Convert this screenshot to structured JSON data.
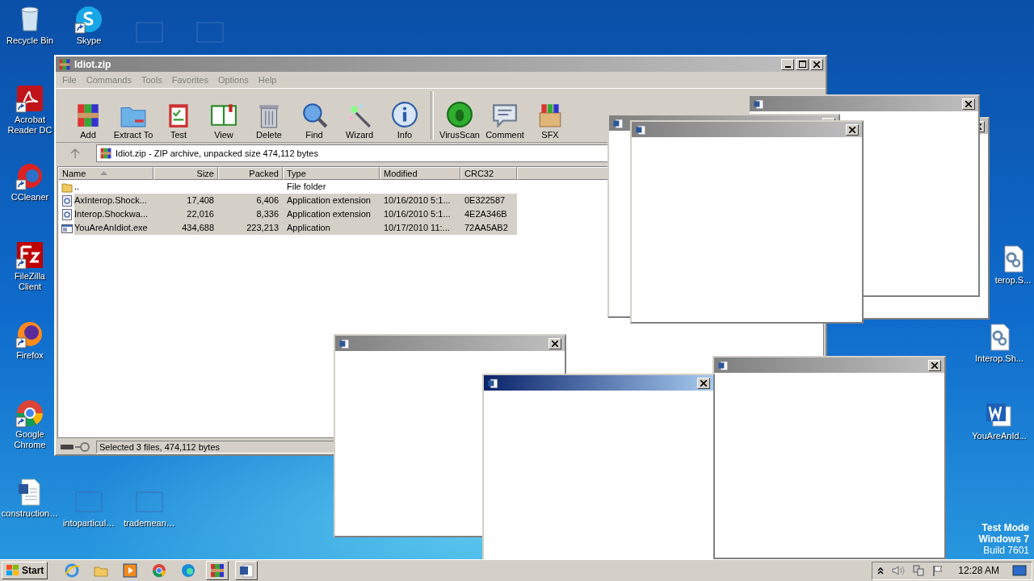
{
  "desktop_icons": [
    {
      "label": "Recycle Bin",
      "kind": "recycle",
      "shortcut": false
    },
    {
      "label": "Skype",
      "kind": "skype",
      "shortcut": true
    },
    {
      "kind": "thumb",
      "shortcut": false
    },
    {
      "kind": "thumb",
      "shortcut": false
    },
    {
      "label": "Acrobat Reader DC",
      "kind": "acrobat",
      "shortcut": true
    },
    {
      "label": "CCleaner",
      "kind": "ccleaner",
      "shortcut": true
    },
    {
      "label": "FileZilla Client",
      "kind": "filezilla",
      "shortcut": true
    },
    {
      "label": "Firefox",
      "kind": "firefox",
      "shortcut": true
    },
    {
      "label": "Google Chrome",
      "kind": "chrome",
      "shortcut": true
    },
    {
      "label": "construction…",
      "kind": "worddoc",
      "shortcut": false
    },
    {
      "label": "intoparticul…",
      "kind": "thumb",
      "shortcut": false
    },
    {
      "label": "trademean…",
      "kind": "thumb",
      "shortcut": false
    },
    {
      "label": "terop.S...",
      "kind": "gear",
      "shortcut": false
    },
    {
      "label": "Interop.Sh...",
      "kind": "gear",
      "shortcut": false
    },
    {
      "label": "YouAreAnId...",
      "kind": "word",
      "shortcut": false
    }
  ],
  "system_notice": [
    {
      "text": "Test Mode",
      "bold": true
    },
    {
      "text": "Windows 7",
      "bold": true
    },
    {
      "text": "Build 7601",
      "bold": false
    }
  ],
  "winrar": {
    "title": "Idiot.zip",
    "menu": [
      "File",
      "Commands",
      "Tools",
      "Favorites",
      "Options",
      "Help"
    ],
    "toolbar": [
      {
        "label": "Add",
        "kind": "add"
      },
      {
        "label": "Extract To",
        "kind": "extract"
      },
      {
        "label": "Test",
        "kind": "test"
      },
      {
        "label": "View",
        "kind": "view"
      },
      {
        "label": "Delete",
        "kind": "delete"
      },
      {
        "label": "Find",
        "kind": "find"
      },
      {
        "label": "Wizard",
        "kind": "wizard"
      },
      {
        "label": "Info",
        "kind": "info"
      },
      {
        "label": "VirusScan",
        "kind": "virus"
      },
      {
        "label": "Comment",
        "kind": "comment"
      },
      {
        "label": "SFX",
        "kind": "sfx"
      }
    ],
    "address": "Idiot.zip - ZIP archive, unpacked size 474,112 bytes",
    "columns": [
      {
        "label": "Name",
        "sorted": true
      },
      {
        "label": "Size",
        "sorted": false
      },
      {
        "label": "Packed",
        "sorted": false
      },
      {
        "label": "Type",
        "sorted": false
      },
      {
        "label": "Modified",
        "sorted": false
      },
      {
        "label": "CRC32",
        "sorted": false
      }
    ],
    "rows": [
      {
        "kind": "folder",
        "name": "..",
        "size": "",
        "packed": "",
        "type": "File folder",
        "modified": "",
        "crc": "",
        "selected": false
      },
      {
        "kind": "dll",
        "name": "AxInterop.Shock...",
        "size": "17,408",
        "packed": "6,406",
        "type": "Application extension",
        "modified": "10/16/2010 5:1...",
        "crc": "0E322587",
        "selected": true
      },
      {
        "kind": "dll",
        "name": "Interop.Shockwa...",
        "size": "22,016",
        "packed": "8,336",
        "type": "Application extension",
        "modified": "10/16/2010 5:1...",
        "crc": "4E2A346B",
        "selected": true
      },
      {
        "kind": "exe",
        "name": "YouAreAnIdiot.exe",
        "size": "434,688",
        "packed": "223,213",
        "type": "Application",
        "modified": "10/17/2010 11:...",
        "crc": "72AA5AB2",
        "selected": true
      }
    ],
    "status": "Selected 3 files, 474,112 bytes"
  },
  "popups": [
    {
      "active": false
    },
    {
      "active": false
    },
    {
      "active": false
    },
    {
      "active": false
    },
    {
      "active": false
    },
    {
      "active": false
    },
    {
      "active": true
    }
  ],
  "taskbar": {
    "start": "Start",
    "apps": [
      {
        "kind": "ie",
        "open": false
      },
      {
        "kind": "explorer",
        "open": false
      },
      {
        "kind": "media",
        "open": false
      },
      {
        "kind": "chrome",
        "open": false
      },
      {
        "kind": "edge",
        "open": false
      },
      {
        "kind": "winrar",
        "open": true
      },
      {
        "kind": "word",
        "open": true
      }
    ],
    "clock": "12:28 AM"
  }
}
